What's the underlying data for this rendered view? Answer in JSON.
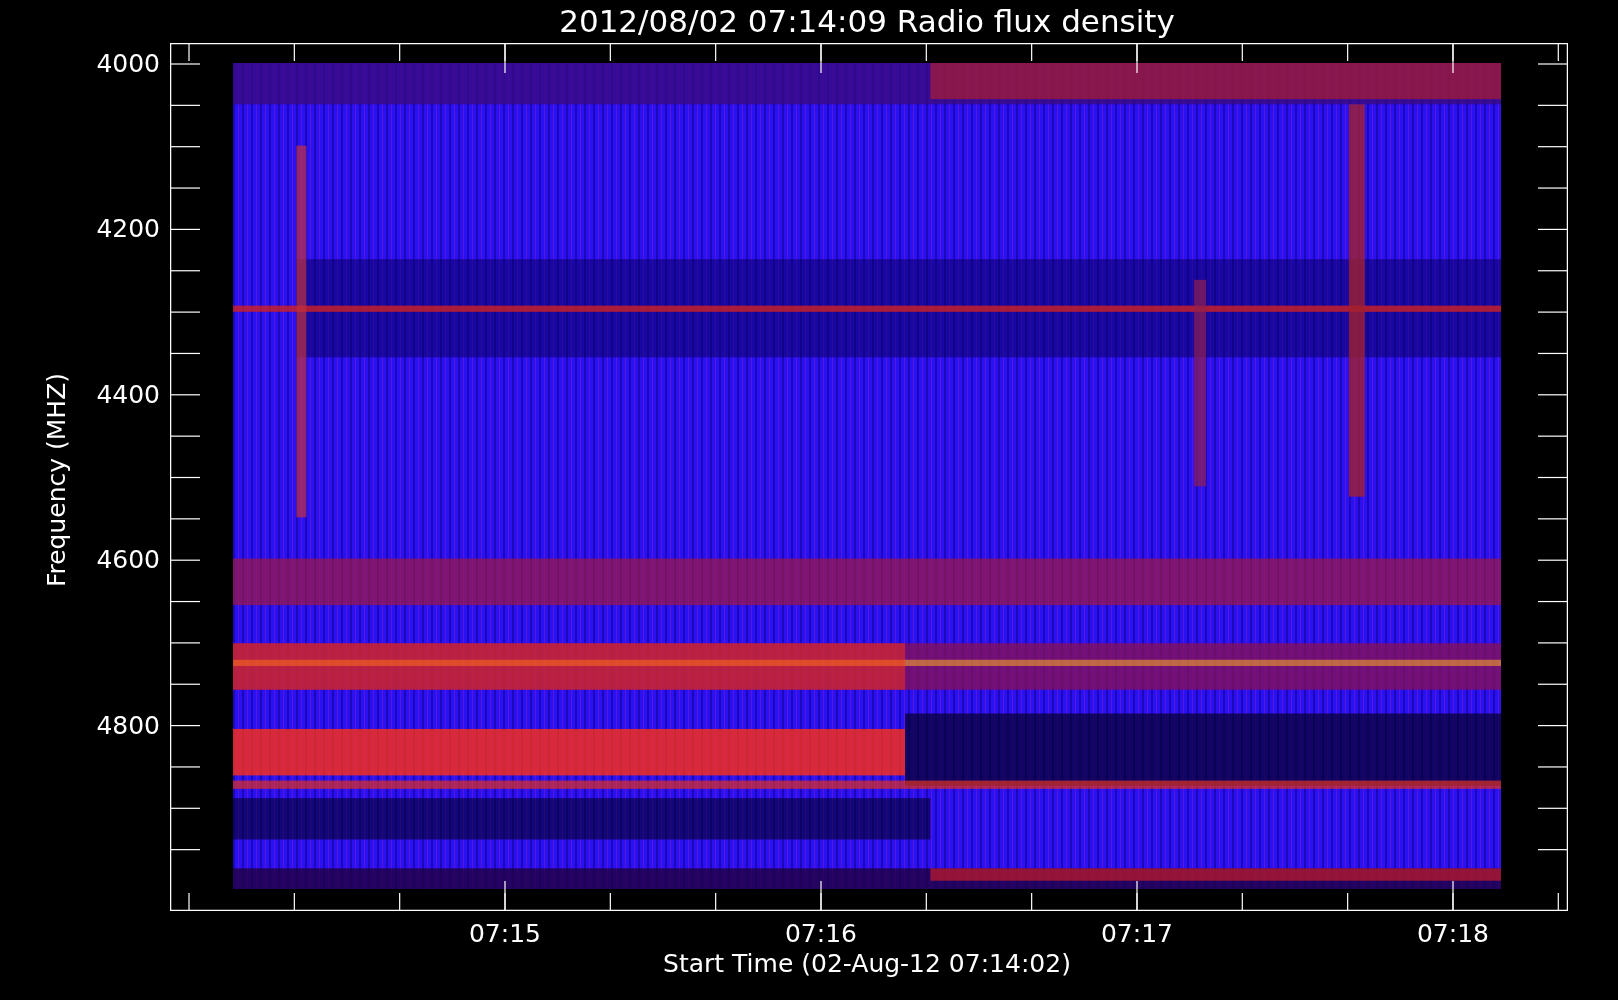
{
  "title": "2012/08/02 07:14:09 Radio flux density",
  "y_axis": {
    "label": "Frequency (MHZ)",
    "ticks": [
      "4000",
      "4200",
      "4400",
      "4600",
      "4800"
    ]
  },
  "x_axis": {
    "label": "Start Time (02-Aug-12 07:14:02)",
    "ticks": [
      "07:15",
      "07:16",
      "07:17",
      "07:18"
    ]
  }
}
